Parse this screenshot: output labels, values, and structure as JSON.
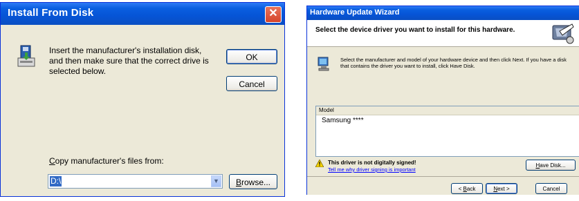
{
  "install_dialog": {
    "title": "Install From Disk",
    "close_glyph": "✕",
    "message": "Insert the manufacturer's installation disk, and then make sure that the correct drive is selected below.",
    "ok_label": "OK",
    "cancel_label": "Cancel",
    "copy_label_accel": "C",
    "copy_label_rest": "opy manufacturer's files from:",
    "path_value": "D:\\",
    "browse_accel": "B",
    "browse_rest": "rowse...",
    "combo_arrow_glyph": "▼",
    "icons": [
      "disk-installer-icon",
      "close-icon",
      "chevron-down-icon"
    ]
  },
  "wizard_dialog": {
    "title": "Hardware Update Wizard",
    "heading": "Select the device driver you want to install for this hardware.",
    "instructions": "Select the manufacturer and model of your hardware device and then click Next. If you have a disk that contains the driver you want to install, click Have Disk.",
    "model_column": "Model",
    "model_item": "Samsung ****",
    "warning": "This driver is not digitally signed!",
    "signing_link": "Tell me why driver signing is important",
    "have_disk_accel": "H",
    "have_disk_rest": "ave Disk...",
    "back_prefix": "< ",
    "back_accel": "B",
    "back_rest": "ack",
    "next_accel": "N",
    "next_rest": "ext >",
    "cancel_label": "Cancel",
    "icons": [
      "hardware-wizard-icon",
      "monitor-icon",
      "warning-icon"
    ]
  },
  "colors": {
    "titlebar": "#0a5fe0",
    "dialog_face": "#ece9d8",
    "selection": "#316ac5",
    "link": "#0000ff",
    "close_button": "#d6442a"
  }
}
